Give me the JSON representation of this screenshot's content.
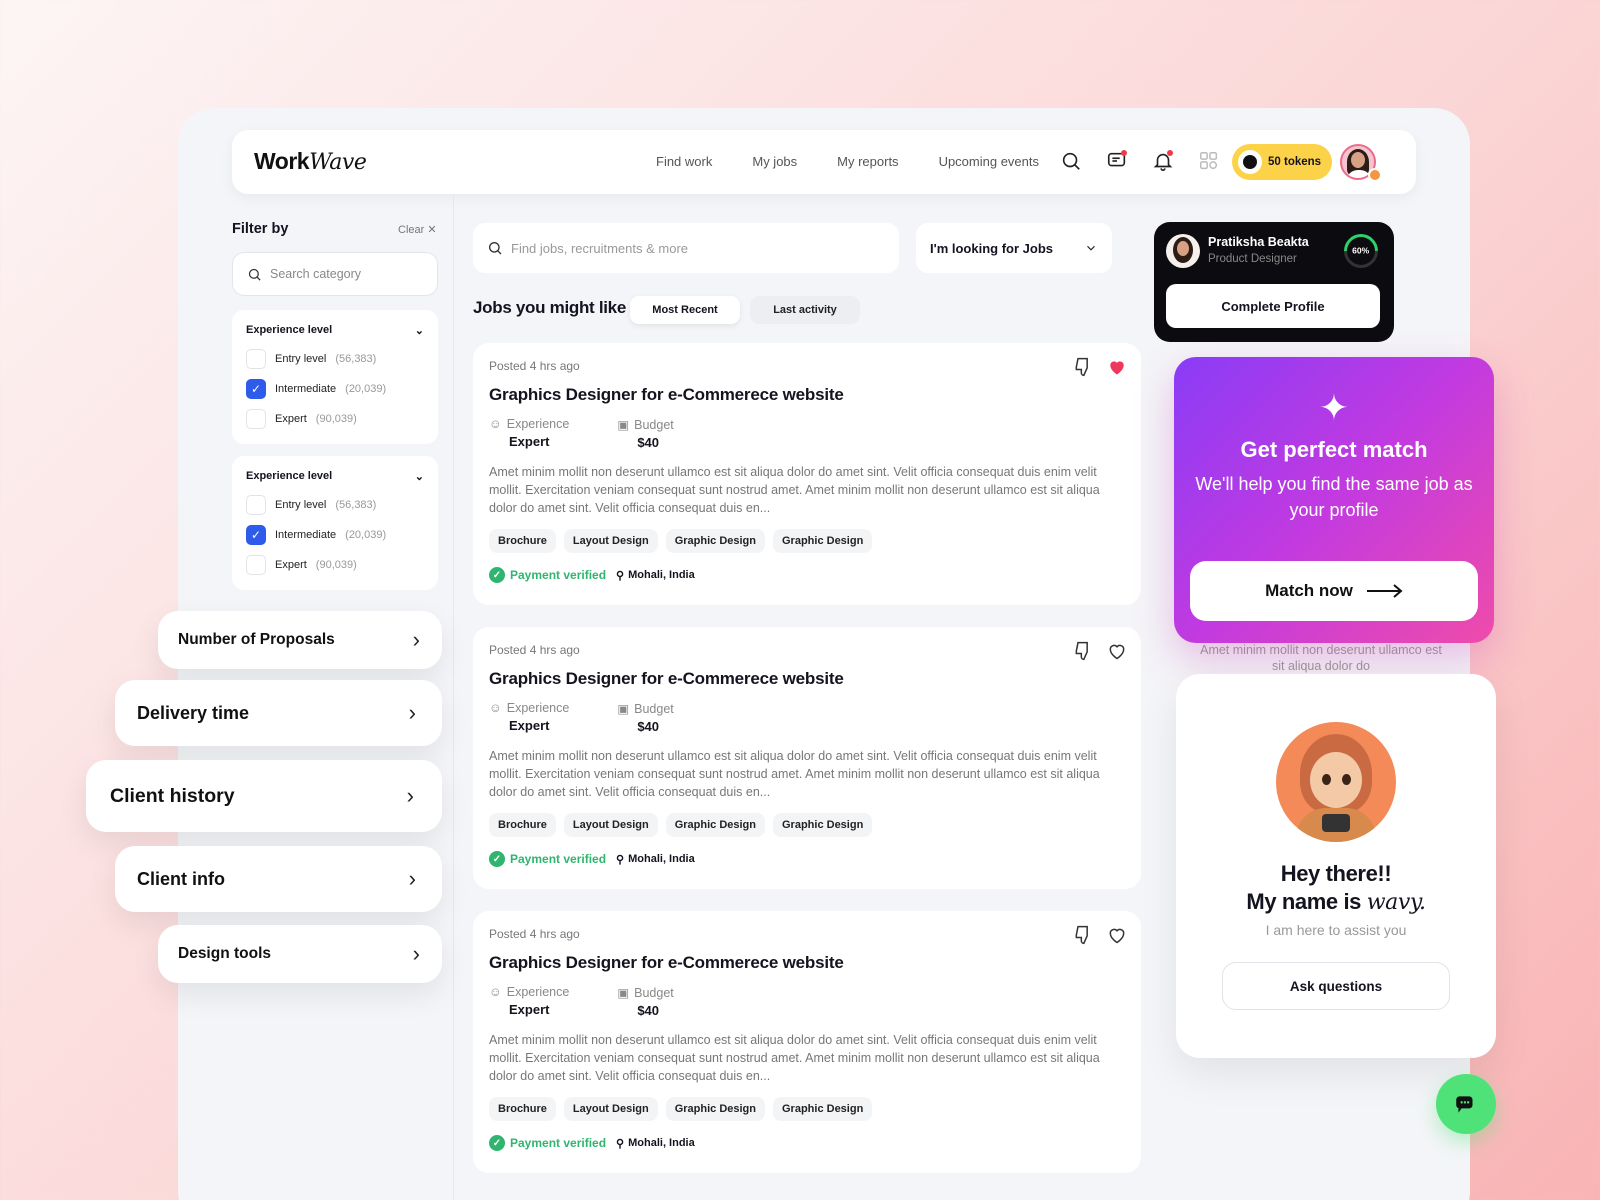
{
  "app": {
    "logo_main": "Work",
    "logo_italic": "Wave"
  },
  "nav": {
    "items": [
      "Find work",
      "My jobs",
      "My reports",
      "Upcoming events"
    ]
  },
  "header": {
    "tokens_label": "50 tokens"
  },
  "filter": {
    "title": "Filter by",
    "clear_label": "Clear ✕",
    "search_placeholder": "Search category",
    "groups": [
      {
        "title": "Experience level",
        "options": [
          {
            "label": "Entry level",
            "count": "(56,383)",
            "checked": false
          },
          {
            "label": "Intermediate",
            "count": "(20,039)",
            "checked": true
          },
          {
            "label": "Expert",
            "count": "(90,039)",
            "checked": false
          }
        ]
      },
      {
        "title": "Experience level",
        "options": [
          {
            "label": "Entry level",
            "count": "(56,383)",
            "checked": false
          },
          {
            "label": "Intermediate",
            "count": "(20,039)",
            "checked": true
          },
          {
            "label": "Expert",
            "count": "(90,039)",
            "checked": false
          }
        ]
      }
    ],
    "sections": [
      "Number of Proposals",
      "Delivery time",
      "Client history",
      "Client info",
      "Design tools"
    ]
  },
  "search": {
    "placeholder": "Find jobs, recruitments & more",
    "looking_for": "I'm looking for Jobs"
  },
  "jobs": {
    "title": "Jobs you might like",
    "tabs": [
      "Most Recent",
      "Last activity"
    ],
    "experience_label": "Experience",
    "budget_label": "Budget",
    "list": [
      {
        "posted": "Posted 4 hrs ago",
        "title": "Graphics Designer for e-Commerece website",
        "experience": "Expert",
        "budget": "$40",
        "description": "Amet minim mollit non deserunt ullamco est sit aliqua dolor do amet sint. Velit officia consequat duis enim velit mollit. Exercitation veniam consequat sunt nostrud amet. Amet minim mollit non deserunt ullamco est sit aliqua dolor do amet sint. Velit officia consequat duis en...",
        "tags": [
          "Brochure",
          "Layout Design",
          "Graphic Design",
          "Graphic Design"
        ],
        "verified": "Payment verified",
        "location": "Mohali, India",
        "liked": true
      },
      {
        "posted": "Posted 4 hrs ago",
        "title": "Graphics Designer for e-Commerece website",
        "experience": "Expert",
        "budget": "$40",
        "description": "Amet minim mollit non deserunt ullamco est sit aliqua dolor do amet sint. Velit officia consequat duis enim velit mollit. Exercitation veniam consequat sunt nostrud amet. Amet minim mollit non deserunt ullamco est sit aliqua dolor do amet sint. Velit officia consequat duis en...",
        "tags": [
          "Brochure",
          "Layout Design",
          "Graphic Design",
          "Graphic Design"
        ],
        "verified": "Payment verified",
        "location": "Mohali, India",
        "liked": false
      },
      {
        "posted": "Posted 4 hrs ago",
        "title": "Graphics Designer for e-Commerece website",
        "experience": "Expert",
        "budget": "$40",
        "description": "Amet minim mollit non deserunt ullamco est sit aliqua dolor do amet sint. Velit officia consequat duis enim velit mollit. Exercitation veniam consequat sunt nostrud amet. Amet minim mollit non deserunt ullamco est sit aliqua dolor do amet sint. Velit officia consequat duis en...",
        "tags": [
          "Brochure",
          "Layout Design",
          "Graphic Design",
          "Graphic Design"
        ],
        "verified": "Payment verified",
        "location": "Mohali, India",
        "liked": false
      }
    ]
  },
  "profile": {
    "name": "Pratiksha Beakta",
    "role": "Product Designer",
    "completion": "60%",
    "cta": "Complete Profile"
  },
  "match": {
    "title": "Get perfect match",
    "subtitle": "We'll help you find the same job as your profile",
    "cta": "Match now",
    "ghost_text": "Amet minim mollit non deserunt ullamco est sit aliqua dolor do"
  },
  "assistant": {
    "greeting_line1": "Hey there!!",
    "greeting_line2": "My name is",
    "bot_name": "wavy.",
    "subtitle": "I am here to assist you",
    "cta": "Ask questions"
  },
  "colors": {
    "accent_blue": "#2f5bea",
    "verified_green": "#2fb56f",
    "token_yellow": "#fcd348",
    "like_red": "#f0375b",
    "chat_green": "#4fe279"
  }
}
